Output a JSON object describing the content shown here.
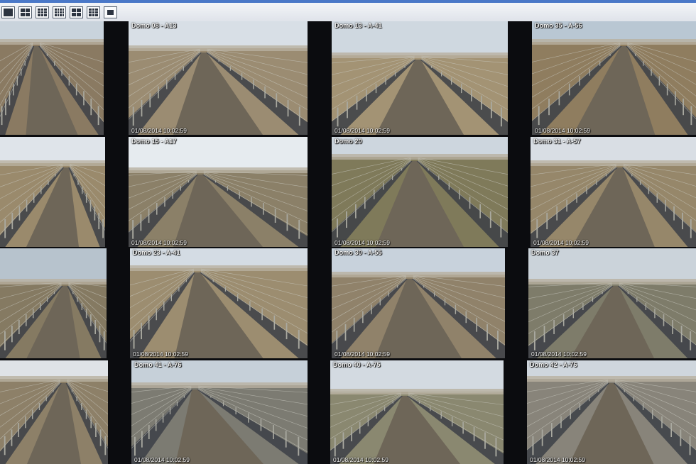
{
  "toolbar": {
    "buttons": [
      {
        "icon": "layout-1x1-icon"
      },
      {
        "icon": "layout-2x2-icon"
      },
      {
        "icon": "layout-3x3-icon"
      },
      {
        "icon": "layout-3x4-icon"
      },
      {
        "icon": "layout-4x4-icon"
      },
      {
        "icon": "layout-5x5-icon"
      },
      {
        "icon": "fullscreen-icon"
      }
    ]
  },
  "cameras": [
    {
      "title": "",
      "timestamp": ""
    },
    {
      "title": "Domo 08 - A13",
      "timestamp": "01/08/2014 10:02:59"
    },
    {
      "title": "Domo 13 - A-41",
      "timestamp": "01/08/2014 10:02:59"
    },
    {
      "title": "Domo 35 - A-56",
      "timestamp": "01/08/2014 10:02:59"
    },
    {
      "title": "",
      "timestamp": ""
    },
    {
      "title": "Domo 15 - A17",
      "timestamp": "01/08/2014 10:02:59"
    },
    {
      "title": "Domo 20",
      "timestamp": "01/08/2014 10:02:59"
    },
    {
      "title": "Domo 31 - A-57",
      "timestamp": "01/08/2014 10:02:59"
    },
    {
      "title": "",
      "timestamp": ""
    },
    {
      "title": "Domo 23 - A-41",
      "timestamp": "01/08/2014 10:02:59"
    },
    {
      "title": "Domo 30 - A-55",
      "timestamp": "01/08/2014 10:02:59"
    },
    {
      "title": "Domo 37",
      "timestamp": "01/08/2014 10:02:59"
    },
    {
      "title": "",
      "timestamp": ""
    },
    {
      "title": "Domo 41 - A-76",
      "timestamp": "01/08/2014 10:02:59"
    },
    {
      "title": "Domo 40 - A-75",
      "timestamp": "01/08/2014 10:02:59"
    },
    {
      "title": "Domo 42 - A-76",
      "timestamp": "01/08/2014 10:02:59"
    }
  ],
  "colors": {
    "toolbar_accent": "#4a78c8",
    "tile_border": "#d7d7c8",
    "background": "#06070a"
  }
}
